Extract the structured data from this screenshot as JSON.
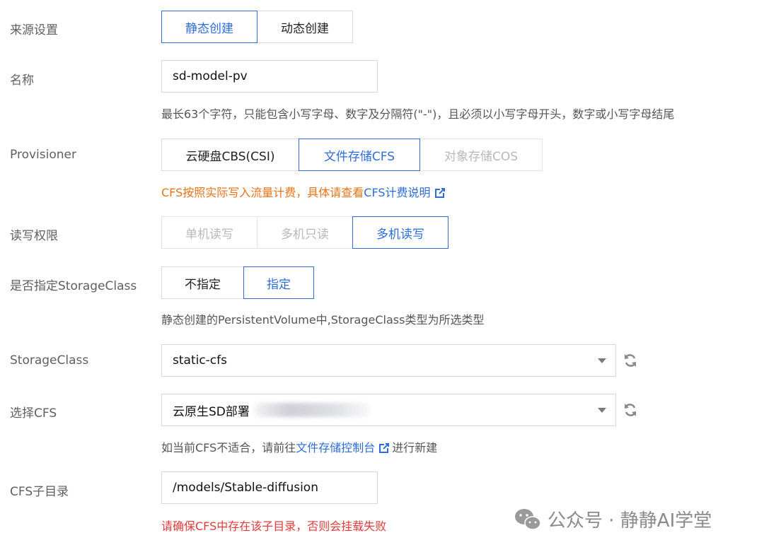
{
  "rows": {
    "source": {
      "label": "来源设置",
      "options": [
        "静态创建",
        "动态创建"
      ],
      "selected": 0
    },
    "name": {
      "label": "名称",
      "value": "sd-model-pv",
      "hint": "最长63个字符，只能包含小写字母、数字及分隔符(\"-\")，且必须以小写字母开头，数字或小写字母结尾"
    },
    "provisioner": {
      "label": "Provisioner",
      "options": [
        "云硬盘CBS(CSI)",
        "文件存储CFS",
        "对象存储COS"
      ],
      "selected": 1,
      "disabled": [
        2
      ],
      "hint_text": "CFS按照实际写入流量计费，具体请查看",
      "hint_link": "CFS计费说明"
    },
    "access": {
      "label": "读写权限",
      "options": [
        "单机读写",
        "多机只读",
        "多机读写"
      ],
      "selected": 2,
      "disabled": [
        0,
        1
      ]
    },
    "specify_sc": {
      "label": "是否指定StorageClass",
      "options": [
        "不指定",
        "指定"
      ],
      "selected": 1,
      "hint": "静态创建的PersistentVolume中,StorageClass类型为所选类型"
    },
    "storage_class": {
      "label": "StorageClass",
      "value": "static-cfs"
    },
    "cfs": {
      "label": "选择CFS",
      "value": "云原生SD部署",
      "hint_before": "如当前CFS不适合，请前往",
      "hint_link": "文件存储控制台",
      "hint_after": "进行新建"
    },
    "cfs_subdir": {
      "label": "CFS子目录",
      "value": "/models/Stable-diffusion",
      "hint": "请确保CFS中存在该子目录，否则会挂载失败"
    }
  },
  "watermark": {
    "text": "公众号 · 静静AI学堂",
    "icon": "wechat-icon"
  },
  "colors": {
    "accent": "#2f6cd8",
    "warning": "#e8741a",
    "error": "#e03c3c",
    "label": "#5f5f5f"
  },
  "icons": {
    "external_link": "external-link-icon",
    "refresh": "refresh-icon",
    "dropdown": "chevron-down-icon"
  }
}
